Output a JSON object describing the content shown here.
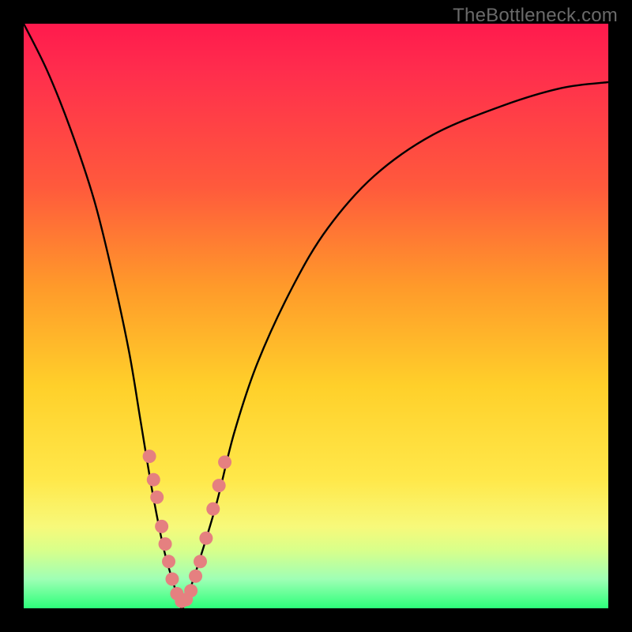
{
  "watermark": "TheBottleneck.com",
  "chart_data": {
    "type": "line",
    "title": "",
    "xlabel": "",
    "ylabel": "",
    "xlim": [
      0,
      100
    ],
    "ylim": [
      0,
      100
    ],
    "grid": false,
    "series": [
      {
        "name": "bottleneck-curve",
        "x": [
          0,
          4,
          8,
          12,
          15,
          18,
          20,
          22,
          24,
          26,
          27,
          28,
          30,
          33,
          36,
          40,
          46,
          52,
          60,
          70,
          82,
          92,
          100
        ],
        "values": [
          100,
          92,
          82,
          70,
          58,
          44,
          32,
          20,
          10,
          3,
          0,
          2,
          8,
          18,
          30,
          42,
          55,
          65,
          74,
          81,
          86,
          89,
          90
        ]
      }
    ],
    "markers": [
      {
        "x": 21.5,
        "y": 26
      },
      {
        "x": 22.2,
        "y": 22
      },
      {
        "x": 22.8,
        "y": 19
      },
      {
        "x": 23.6,
        "y": 14
      },
      {
        "x": 24.2,
        "y": 11
      },
      {
        "x": 24.8,
        "y": 8
      },
      {
        "x": 25.4,
        "y": 5
      },
      {
        "x": 26.2,
        "y": 2.5
      },
      {
        "x": 27.0,
        "y": 1.2
      },
      {
        "x": 27.8,
        "y": 1.5
      },
      {
        "x": 28.6,
        "y": 3
      },
      {
        "x": 29.4,
        "y": 5.5
      },
      {
        "x": 30.2,
        "y": 8
      },
      {
        "x": 31.2,
        "y": 12
      },
      {
        "x": 32.4,
        "y": 17
      },
      {
        "x": 33.4,
        "y": 21
      },
      {
        "x": 34.4,
        "y": 25
      }
    ],
    "gradient_steps": [
      {
        "pos": 0,
        "color": "#ff1a4d"
      },
      {
        "pos": 28,
        "color": "#ff5a3c"
      },
      {
        "pos": 62,
        "color": "#ffd02a"
      },
      {
        "pos": 86,
        "color": "#f7f97a"
      },
      {
        "pos": 100,
        "color": "#2cff7a"
      }
    ]
  }
}
